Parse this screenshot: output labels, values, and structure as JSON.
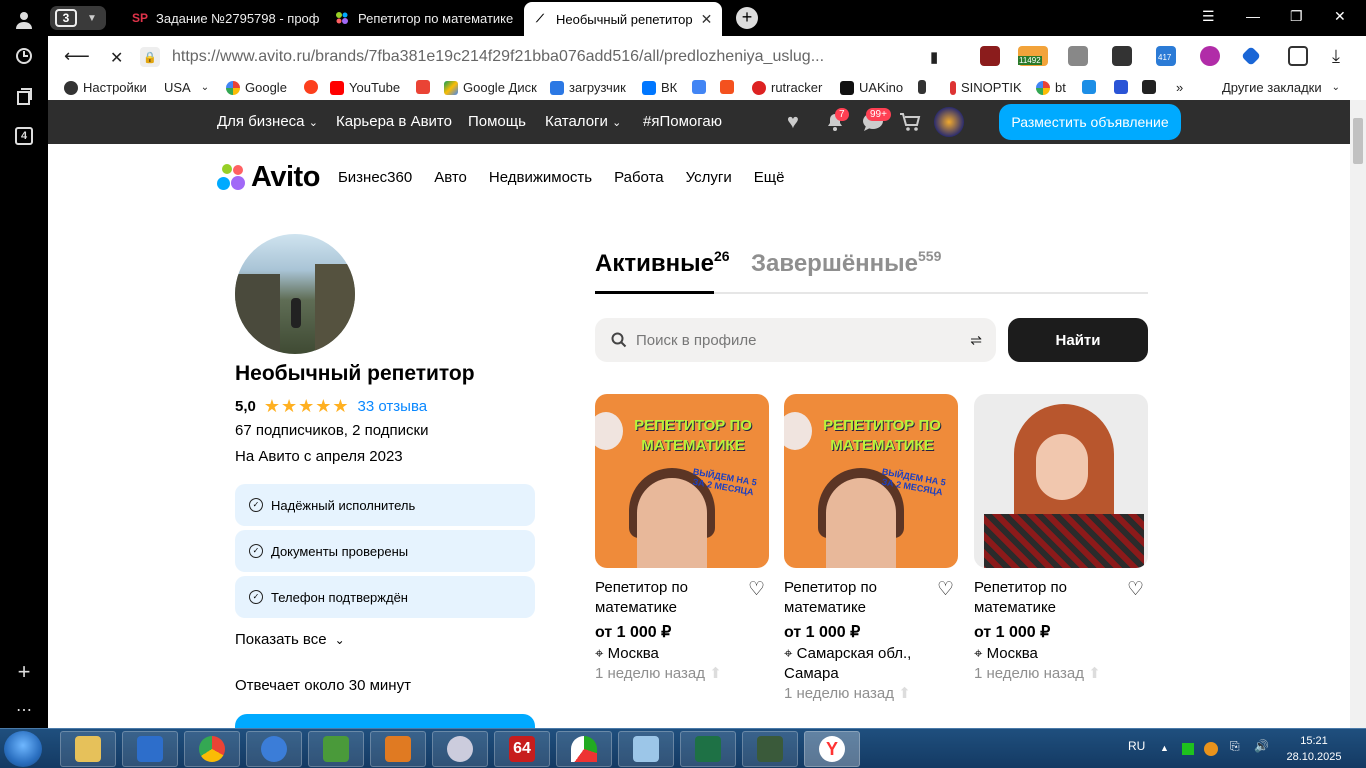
{
  "browser": {
    "tab_count": "3",
    "tabs": [
      {
        "favicon": "SP",
        "title": "Задание №2795798 - проф"
      },
      {
        "favicon": "",
        "title": "Репетитор по математике"
      },
      {
        "favicon": "",
        "title": "Необычный репетитор"
      }
    ],
    "url": "https://www.avito.ru/brands/7fba381e19c214f29f21bba076add516/all/predlozheniya_uslug...",
    "side_badge": "4",
    "bookmarks": [
      "Настройки",
      "USA",
      "Google",
      "YouTube",
      "Google Диск",
      "загрузчик",
      "ВК",
      "rutracker",
      "UAKino",
      "SINOPTIK",
      "bt",
      "Другие закладки"
    ],
    "ext_badges": {
      "counter": "11492",
      "calendar": "417"
    }
  },
  "site": {
    "topnav": [
      "Для бизнеса",
      "Карьера в Авито",
      "Помощь",
      "Каталоги",
      "#яПомогаю"
    ],
    "notifications_badge": "7",
    "messages_badge": "99+",
    "post_button": "Разместить объявление",
    "logo": "Avito",
    "menu": [
      "Бизнес360",
      "Авто",
      "Недвижимость",
      "Работа",
      "Услуги",
      "Ещё"
    ]
  },
  "profile": {
    "name": "Необычный репетитор",
    "rating": "5,0",
    "stars": "★★★★★",
    "reviews": "33 отзыва",
    "subs": "67 подписчиков, 2 подписки",
    "since": "На Авито с апреля 2023",
    "badges": [
      "Надёжный исполнитель",
      "Документы проверены",
      "Телефон подтверждён"
    ],
    "show_all": "Показать все",
    "responds": "Отвечает около 30 минут"
  },
  "listing": {
    "tab_active": "Активные",
    "tab_active_count": "26",
    "tab_done": "Завершённые",
    "tab_done_count": "559",
    "search_placeholder": "Поиск в профиле",
    "find_button": "Найти",
    "promo_text": "РЕПЕТИТОР ПО МАТЕМАТИКЕ",
    "promo_sub": "ВЫЙДЕМ НА 5 ЗА 2 МЕСЯЦА",
    "cards": [
      {
        "title": "Репетитор по математике",
        "price": "от 1 000 ₽",
        "loc": "Москва",
        "ago": "1 неделю назад"
      },
      {
        "title": "Репетитор по математике",
        "price": "от 1 000 ₽",
        "loc": "Самарская обл., Самара",
        "ago": "1 неделю назад"
      },
      {
        "title": "Репетитор по математике",
        "price": "от 1 000 ₽",
        "loc": "Москва",
        "ago": "1 неделю назад"
      }
    ]
  },
  "taskbar": {
    "lang": "RU",
    "time": "15:21",
    "date": "28.10.2025",
    "app_64": "64"
  }
}
